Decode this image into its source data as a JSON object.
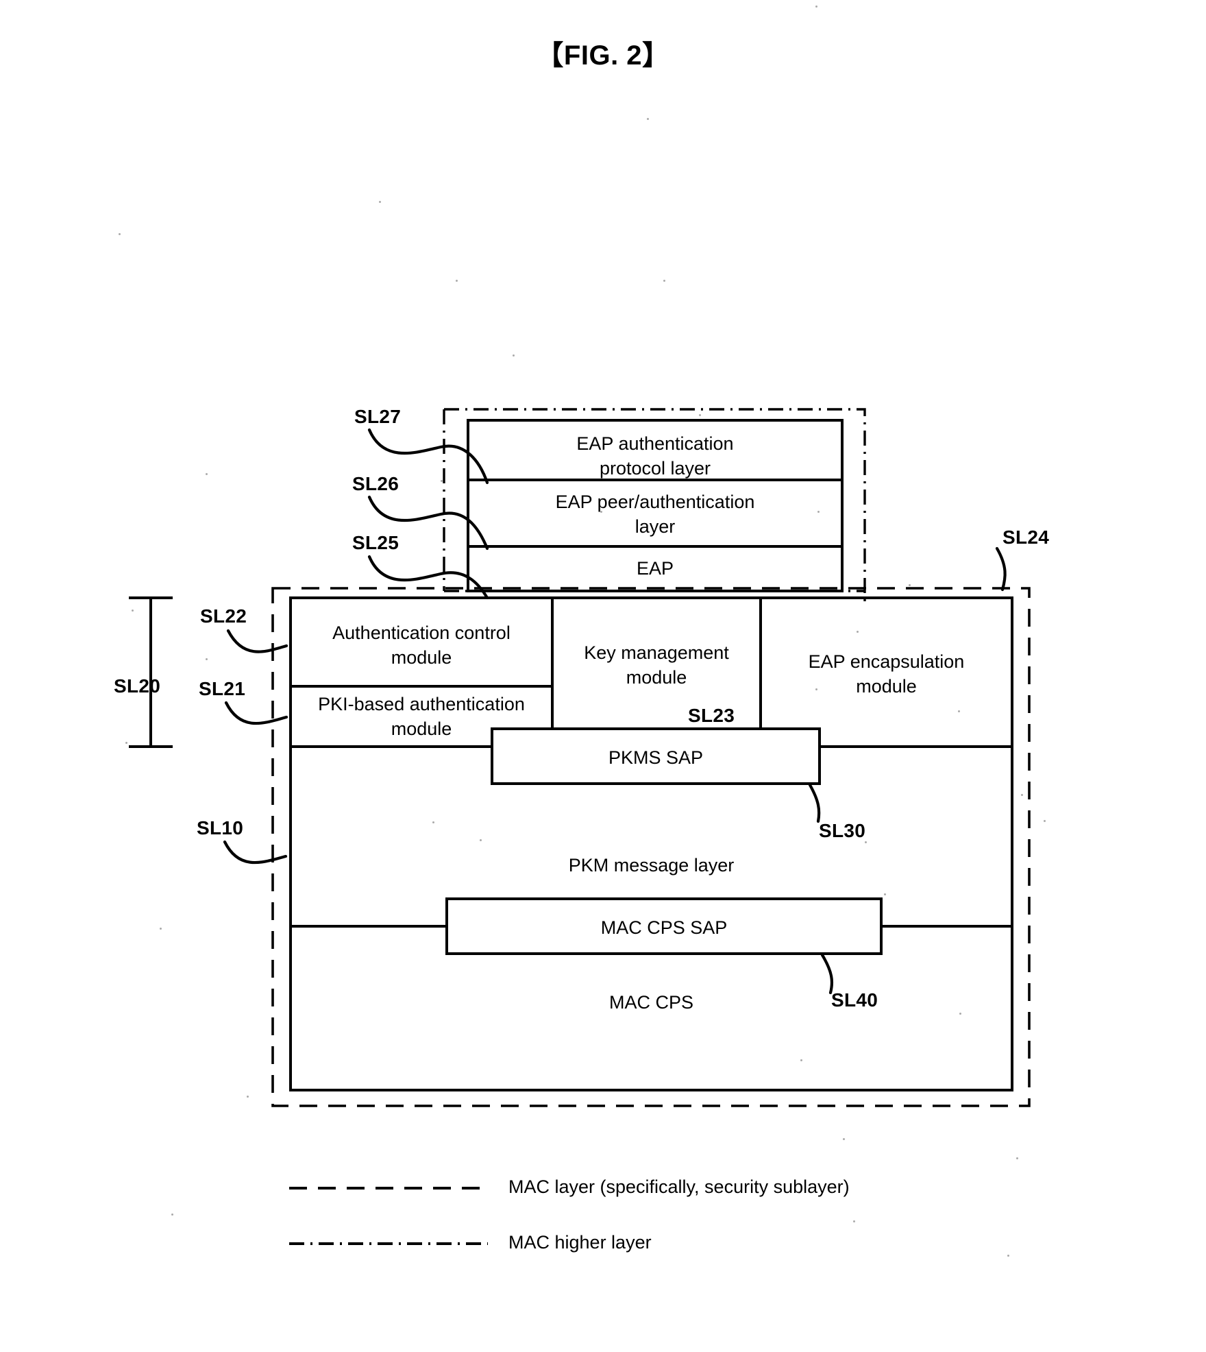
{
  "figure": {
    "title": "【FIG. 2】"
  },
  "higher_layer_stack": {
    "boxes": [
      {
        "id": "eap-auth-protocol-layer",
        "label": "EAP authentication\nprotocol layer",
        "ref": "SL27"
      },
      {
        "id": "eap-peer-auth-layer",
        "label": "EAP peer/authentication\nlayer",
        "ref": "SL26"
      },
      {
        "id": "eap-layer",
        "label": "EAP",
        "ref": "SL25"
      }
    ]
  },
  "security_sublayer": {
    "ref": "SL24",
    "modules": [
      {
        "id": "authentication-control-module",
        "label": "Authentication control\nmodule",
        "ref": "SL22"
      },
      {
        "id": "pki-based-authentication-module",
        "label": "PKI-based authentication\nmodule",
        "ref": "SL21"
      },
      {
        "id": "key-management-module",
        "label": "Key management\nmodule",
        "ref": "SL23"
      },
      {
        "id": "eap-encapsulation-module",
        "label": "EAP encapsulation\nmodule",
        "ref": ""
      }
    ],
    "group_ref": "SL20",
    "service_access_points": [
      {
        "id": "pkms-sap",
        "label": "PKMS SAP",
        "ref": "SL30"
      },
      {
        "id": "mac-cps-sap",
        "label": "MAC CPS SAP",
        "ref": "SL40"
      }
    ],
    "layers": [
      {
        "id": "pkm-message-layer",
        "label": "PKM message layer",
        "ref": "SL10"
      },
      {
        "id": "mac-cps-layer",
        "label": "MAC CPS",
        "ref": ""
      }
    ]
  },
  "reference_labels": {
    "sl10": "SL10",
    "sl20": "SL20",
    "sl21": "SL21",
    "sl22": "SL22",
    "sl23": "SL23",
    "sl24": "SL24",
    "sl25": "SL25",
    "sl26": "SL26",
    "sl27": "SL27",
    "sl30": "SL30",
    "sl40": "SL40"
  },
  "box_labels": {
    "eap_auth_protocol_l1": "EAP authentication",
    "eap_auth_protocol_l2": "protocol layer",
    "eap_peer_auth_l1": "EAP peer/authentication",
    "eap_peer_auth_l2": "layer",
    "eap": "EAP",
    "auth_control_l1": "Authentication control",
    "auth_control_l2": "module",
    "pki_based_l1": "PKI-based authentication",
    "pki_based_l2": "module",
    "key_mgmt_l1": "Key management",
    "key_mgmt_l2": "module",
    "eap_encap_l1": "EAP encapsulation",
    "eap_encap_l2": "module",
    "pkms_sap": "PKMS SAP",
    "pkm_message_layer": "PKM message layer",
    "mac_cps_sap": "MAC CPS SAP",
    "mac_cps": "MAC CPS"
  },
  "legend": {
    "items": [
      {
        "id": "legend-mac-layer",
        "line_style": "dashed",
        "label": "MAC layer (specifically, security sublayer)"
      },
      {
        "id": "legend-mac-higher-layer",
        "line_style": "dash-dot",
        "label": "MAC higher layer"
      }
    ]
  },
  "colors": {
    "ink": "#000000",
    "paper": "#ffffff"
  }
}
